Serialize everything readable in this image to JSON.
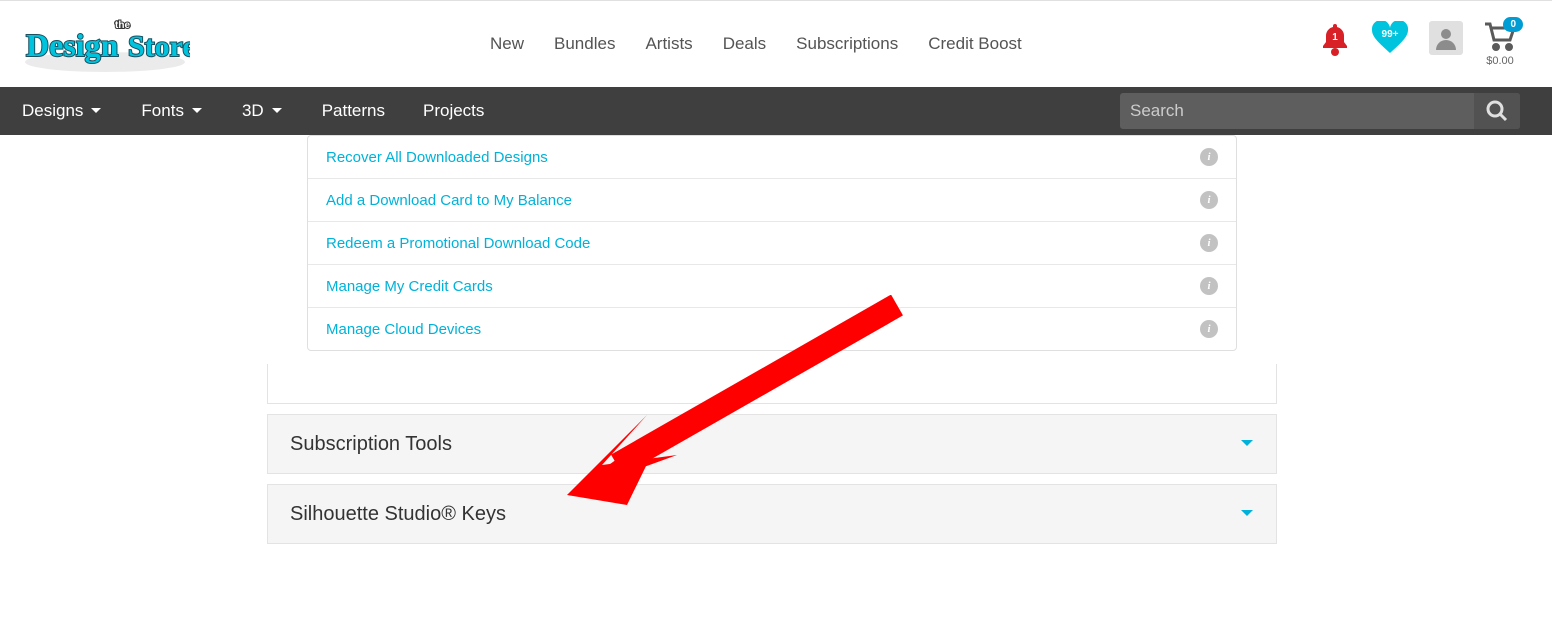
{
  "header": {
    "nav": [
      "New",
      "Bundles",
      "Artists",
      "Deals",
      "Subscriptions",
      "Credit Boost"
    ],
    "notif_count": "1",
    "heart_count": "99+",
    "cart_count": "0",
    "cart_total": "$0.00"
  },
  "secondary_nav": {
    "items": [
      "Designs",
      "Fonts",
      "3D",
      "Patterns",
      "Projects"
    ],
    "dropdown_flags": [
      true,
      true,
      true,
      false,
      false
    ],
    "search_placeholder": "Search"
  },
  "account_links": [
    "Recover All Downloaded Designs",
    "Add a Download Card to My Balance",
    "Redeem a Promotional Download Code",
    "Manage My Credit Cards",
    "Manage Cloud Devices"
  ],
  "accordions": [
    {
      "title": "Subscription Tools"
    },
    {
      "title": "Silhouette Studio® Keys"
    }
  ]
}
